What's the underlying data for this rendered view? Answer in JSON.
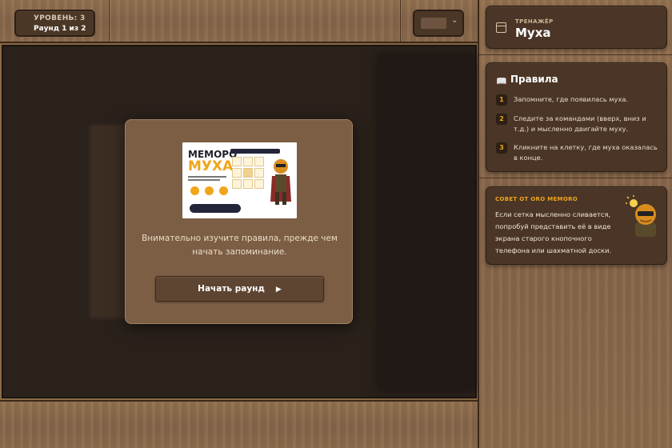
{
  "header": {
    "level_label": "УРОВЕНЬ: 3",
    "round_label": "Раунд 1 из 2",
    "selector_chevron": "⌄"
  },
  "modal": {
    "preview": {
      "title_line1": "МЕМОРО",
      "title_line2": "МУХА"
    },
    "intro_text": "Внимательно изучите правила, прежде чем начать запоминание.",
    "start_button": "Начать раунд",
    "start_icon": "play-icon"
  },
  "sidebar": {
    "trainer": {
      "subtitle": "ТРЕНАЖЁР",
      "title": "Муха",
      "icon": "calendar-icon"
    },
    "rules": {
      "heading": "Правила",
      "icon": "book-icon",
      "items": [
        {
          "num": "1",
          "text": "Запомните, где появилась муха."
        },
        {
          "num": "2",
          "text": "Следите за командами (вверх, вниз и т.д.) и мысленно двигайте муху."
        },
        {
          "num": "3",
          "text": "Кликните на клетку, где муха оказалась в конце."
        }
      ]
    },
    "tip": {
      "label": "СОВЕТ ОТ ORO MEMORO",
      "text": "Если сетка мысленно сливается, попробуй представить её в виде экрана старого кнопочного телефона или шахматной доски.",
      "icon": "mascot-icon"
    }
  },
  "colors": {
    "accent": "#f0a51c",
    "panel": "#4a3526",
    "wood": "#8a6a48",
    "play_area": "#2a211b"
  }
}
